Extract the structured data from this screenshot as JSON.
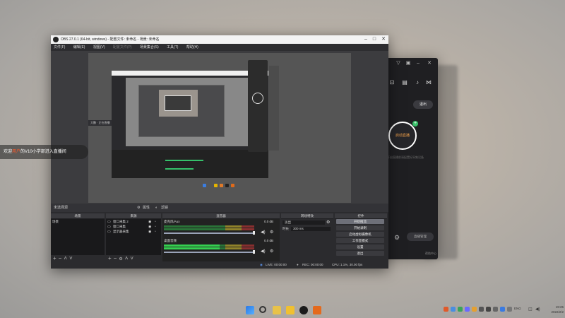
{
  "obs": {
    "title": "OBS 27.0.1 (64-bit, windows) - 配置文件: 未命名 - 场景: 未命名",
    "menu": [
      "文件(F)",
      "编辑(E)",
      "视图(V)",
      "配置文件(P)",
      "场景集合(S)",
      "工具(T)",
      "帮助(H)"
    ],
    "dock_head": {
      "no_source": "未选择源",
      "properties": "属性",
      "filters": "滤镜"
    },
    "scenes": {
      "header": "场景",
      "items": [
        "场景"
      ]
    },
    "sources": {
      "header": "来源",
      "items": [
        "窗口采集 2",
        "窗口采集",
        "显示器采集"
      ]
    },
    "mixer": {
      "header": "混音器",
      "tracks": [
        {
          "name": "麦克风/Aux",
          "db": "0.0 dB",
          "level": 0.0
        },
        {
          "name": "桌面音频",
          "db": "0.0 dB",
          "level": 0.62
        }
      ]
    },
    "transitions": {
      "header": "转场特效",
      "type": "淡出",
      "duration_label": "时长",
      "duration": "300 ms"
    },
    "controls": {
      "header": "控件",
      "buttons": [
        "开始推流",
        "开始录制",
        "启动虚拟摄像机",
        "工作室模式",
        "设置",
        "退出"
      ]
    },
    "status": {
      "live": "LIVE: 00:00:00",
      "rec": "REC: 00:00:00",
      "cpu": "CPU: 1.1%, 30.00 fps"
    }
  },
  "welcome": {
    "prefix": "欢迎",
    "highlight": "用户",
    "suffix": "的V10小学部进入直播间"
  },
  "side_app": {
    "logout": "退出",
    "start": "启动直播",
    "hint": "开启直播前请配置好采集设备",
    "btn2": "直播管理",
    "bottom": "帮助中心"
  },
  "nested": {
    "label": "大鹏 · 正在直播"
  },
  "taskbar": {
    "ime": "ENG",
    "time": "19:25",
    "date": "2022/2/2"
  },
  "colors": {
    "accent_green": "#35c06a",
    "highlight_orange": "#ff5a2a",
    "start_ring": "#f4a24a"
  }
}
